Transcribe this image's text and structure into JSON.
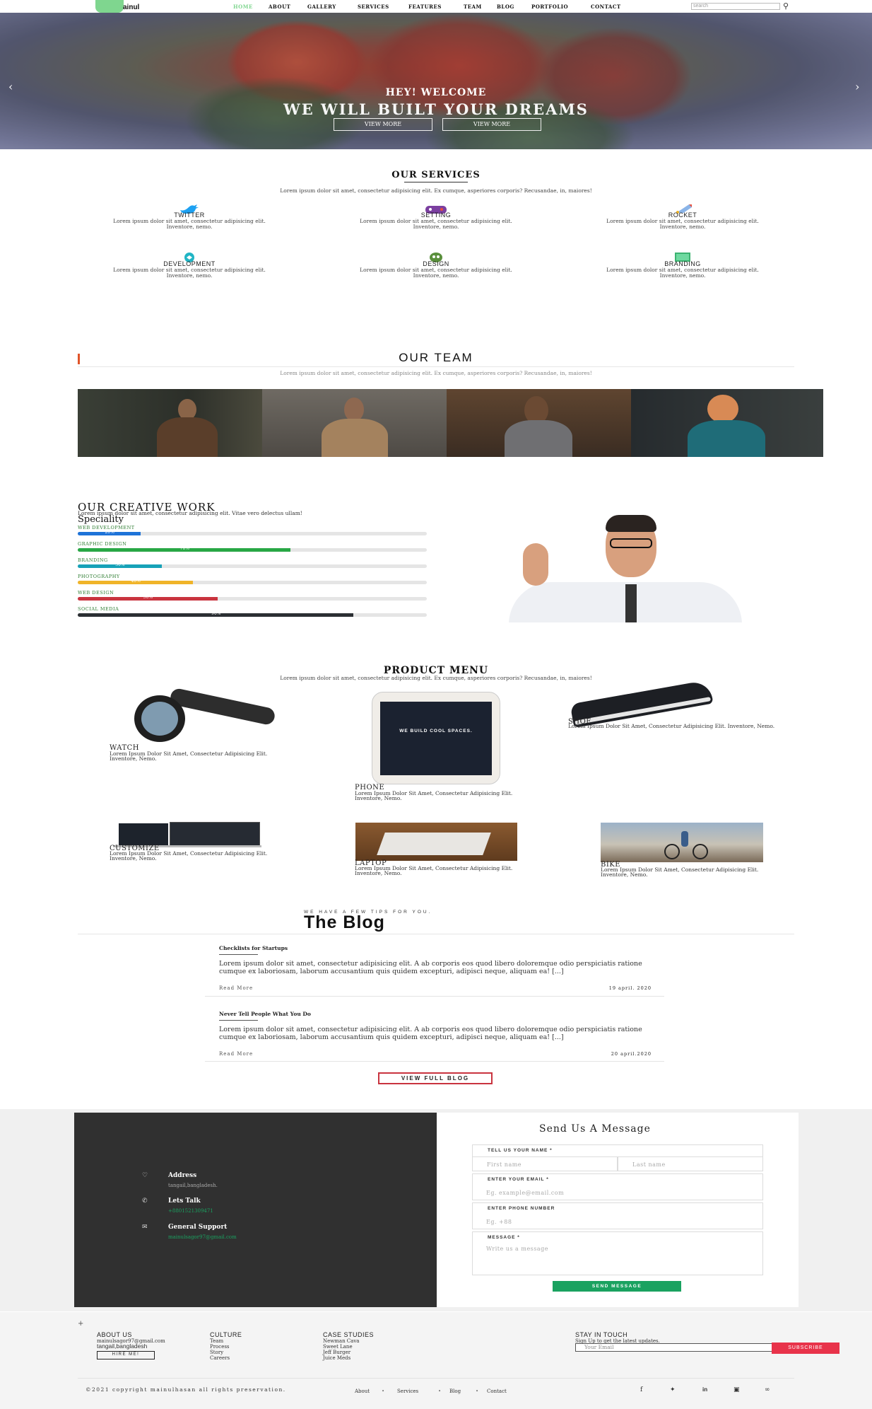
{
  "nav": {
    "logo_text": "ainul",
    "items": [
      "HOME",
      "ABOUT",
      "GALLERY",
      "SERVICES",
      "FEATURES",
      "TEAM",
      "BLOG",
      "PORTFOLIO",
      "CONTACT"
    ],
    "search_placeholder": "search"
  },
  "hero": {
    "subtitle": "HEY! WELCOME",
    "title": "WE WILL BUILT YOUR DREAMS",
    "btn_view_more": "VIEW MORE",
    "btn_view_more_2": "VIEW MORE"
  },
  "services": {
    "title": "OUR SERVICES",
    "subtitle": "Lorem ipsum dolor sit amet, consectetur adipisicing elit. Ex cumque, asperiores corporis? Recusandae, in, maiores!",
    "items": [
      {
        "name": "TWITTER",
        "desc": "Lorem ipsum dolor sit amet, consectetur adipisicing elit. Inventore, nemo.",
        "color": "#1da1f2"
      },
      {
        "name": "SETTING",
        "desc": "Lorem ipsum dolor sit amet, consectetur adipisicing elit. Inventore, nemo.",
        "color": "#7b3fa0"
      },
      {
        "name": "ROCKET",
        "desc": "Lorem ipsum dolor sit amet, consectetur adipisicing elit. Inventore, nemo.",
        "color": "#e94e3c"
      },
      {
        "name": "DEVELOPMENT",
        "desc": "Lorem ipsum dolor sit amet, consectetur adipisicing elit. Inventore, nemo.",
        "color": "#21b5c5"
      },
      {
        "name": "DESIGN",
        "desc": "Lorem ipsum dolor sit amet, consectetur adipisicing elit. Inventore, nemo.",
        "color": "#5a8f3c"
      },
      {
        "name": "BRANDING",
        "desc": "Lorem ipsum dolor sit amet, consectetur adipisicing elit. Inventore, nemo.",
        "color": "#3cb371"
      }
    ]
  },
  "team": {
    "title": "OUR TEAM",
    "subtitle": "Lorem ipsum dolor sit amet, consectetur adipisicing elit. Ex cumque, asperiores corporis? Recusandae, in, maiores!"
  },
  "creative": {
    "title": "OUR CREATIVE WORK",
    "subtitle": "Lorem ipsum dolor sit amet, consectetur adipisicing elit. Vitae vero delectus ullam!",
    "speciality": "Speciality",
    "skills": [
      {
        "label": "WEB DEVELOPMENT",
        "pct": "20%",
        "value": 0.18,
        "color": "#1e73d8"
      },
      {
        "label": "GRAPHIC DESIGN",
        "pct": "70%",
        "value": 0.61,
        "color": "#28a745"
      },
      {
        "label": "BRANDING",
        "pct": "30%",
        "value": 0.24,
        "color": "#17a2b8"
      },
      {
        "label": "PHOTOGRAPHY",
        "pct": "40%",
        "value": 0.33,
        "color": "#f0b429"
      },
      {
        "label": "WEB DESIGN",
        "pct": "50%",
        "value": 0.4,
        "color": "#c9343f"
      },
      {
        "label": "SOCIAL MEDIA",
        "pct": "90%",
        "value": 0.79,
        "color": "#2b2f33"
      }
    ]
  },
  "products": {
    "title": "PRODUCT MENU",
    "subtitle": "Lorem ipsum dolor sit amet, consectetur adipisicing elit. Ex cumque, asperiores corporis? Recusandae, in, maiores!",
    "items": [
      {
        "name": "WATCH",
        "desc": "Lorem Ipsum Dolor Sit Amet, Consectetur Adipisicing Elit. Inventore, Nemo."
      },
      {
        "name": "PHONE",
        "desc": "Lorem Ipsum Dolor Sit Amet, Consectetur Adipisicing Elit. Inventore, Nemo."
      },
      {
        "name": "SHOE",
        "desc": "Lorem Ipsum Dolor Sit Amet, Consectetur Adipisicing Elit. Inventore, Nemo."
      },
      {
        "name": "CUSTOMIZE",
        "desc": "Lorem Ipsum Dolor Sit Amet, Consectetur Adipisicing Elit. Inventore, Nemo."
      },
      {
        "name": "LAPTOP",
        "desc": "Lorem Ipsum Dolor Sit Amet, Consectetur Adipisicing Elit. Inventore, Nemo."
      },
      {
        "name": "BIKE",
        "desc": "Lorem Ipsum Dolor Sit Amet, Consectetur Adipisicing Elit. Inventore, Nemo."
      }
    ],
    "phone_screen_text": "WE BUILD COOL SPACES."
  },
  "blog": {
    "kicker": "WE HAVE A FEW TIPS FOR YOU.",
    "title": "The Blog",
    "posts": [
      {
        "title": "Checklists for Startups",
        "text": "Lorem ipsum dolor sit amet, consectetur adipisicing elit. A ab corporis eos quod libero doloremque odio perspiciatis ratione cumque ex laboriosam, laborum accusantium quis quidem excepturi, adipisci neque, aliquam ea! [...]",
        "more": "Read More",
        "date": "19 april. 2020"
      },
      {
        "title": "Never Tell People What You Do",
        "text": "Lorem ipsum dolor sit amet, consectetur adipisicing elit. A ab corporis eos quod libero doloremque odio perspiciatis ratione cumque ex laboriosam, laborum accusantium quis quidem excepturi, adipisci neque, aliquam ea! [...]",
        "more": "Read More",
        "date": "20 april.2020"
      }
    ],
    "full_btn": "VIEW FULL BLOG"
  },
  "contact": {
    "address_title": "Address",
    "address": "tangail,bangladesh.",
    "talk_title": "Lets Talk",
    "phone": "+8801521309471",
    "support_title": "General Support",
    "email": "mainulsagor97@gmail.com",
    "form_title": "Send Us A Message",
    "name_label": "TELL US YOUR NAME *",
    "first_name": "First name",
    "last_name": "Last name",
    "email_label": "ENTER YOUR EMAIL *",
    "email_ph": "Eg. example@email.com",
    "phone_label": "ENTER PHONE NUMBER",
    "phone_ph": "Eg. +88",
    "msg_label": "MESSAGE *",
    "msg_ph": "Write us a message",
    "send_btn": "SEND MESSAGE",
    "accent": "#1aa260"
  },
  "footer": {
    "about_h": "ABOUT US",
    "about_email": "mainulsagor97@gmail.com",
    "about_loc": "tangail,bangladesh",
    "hire_btn": "HIRE ME!",
    "culture_h": "CULTURE",
    "culture_items": [
      "Team",
      "Process",
      "Story",
      "Careers"
    ],
    "case_h": "CASE STUDIES",
    "case_items": [
      "Newman Cava",
      "Sweet Lane",
      "Jeff Burger",
      "Juice Meds"
    ],
    "stay_h": "STAY IN TOUCH",
    "stay_sub": "Sign Up to get the latest updates.",
    "email_ph": "Your Email",
    "subscribe": "SUBSCRIBE",
    "copyright": "©2021 copyright mainulhasan all rights preservation.",
    "links": [
      "About",
      "Services",
      "Blog",
      "Contact"
    ],
    "subscribe_color": "#e8334a"
  }
}
